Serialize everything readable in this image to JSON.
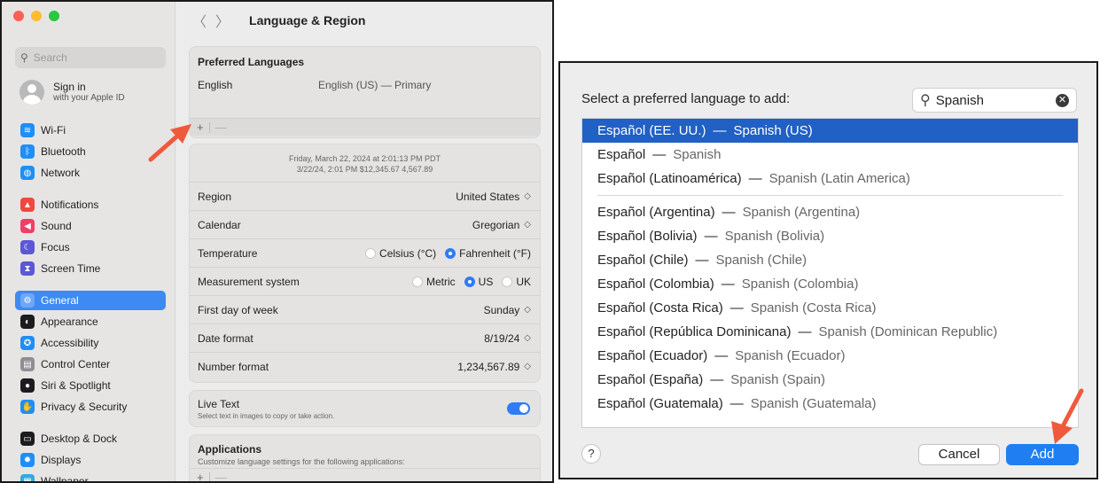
{
  "settings_window": {
    "search_placeholder": "Search",
    "account": {
      "title": "Sign in",
      "subtitle": "with your Apple ID"
    },
    "sidebar_groups": [
      [
        {
          "label": "Wi-Fi",
          "icon": "wifi-icon",
          "color": "#1f8ef6"
        },
        {
          "label": "Bluetooth",
          "icon": "bluetooth-icon",
          "color": "#1f8ef6"
        },
        {
          "label": "Network",
          "icon": "globe-icon",
          "color": "#1f8ef6"
        }
      ],
      [
        {
          "label": "Notifications",
          "icon": "bell-icon",
          "color": "#f0473e"
        },
        {
          "label": "Sound",
          "icon": "speaker-icon",
          "color": "#f03e67"
        },
        {
          "label": "Focus",
          "icon": "moon-icon",
          "color": "#5b57d6"
        },
        {
          "label": "Screen Time",
          "icon": "hourglass-icon",
          "color": "#5b57d6"
        }
      ],
      [
        {
          "label": "General",
          "icon": "gear-icon",
          "color": "#8e8e93",
          "active": true
        },
        {
          "label": "Appearance",
          "icon": "appearance-icon",
          "color": "#1c1c1e"
        },
        {
          "label": "Accessibility",
          "icon": "accessibility-icon",
          "color": "#1f8ef6"
        },
        {
          "label": "Control Center",
          "icon": "control-center-icon",
          "color": "#8e8e93"
        },
        {
          "label": "Siri & Spotlight",
          "icon": "siri-icon",
          "color": "#1c1c1e"
        },
        {
          "label": "Privacy & Security",
          "icon": "hand-icon",
          "color": "#1f8ef6"
        }
      ],
      [
        {
          "label": "Desktop & Dock",
          "icon": "dock-icon",
          "color": "#1c1c1e"
        },
        {
          "label": "Displays",
          "icon": "sun-icon",
          "color": "#1f8ef6"
        },
        {
          "label": "Wallpaper",
          "icon": "wallpaper-icon",
          "color": "#34aadc"
        }
      ]
    ],
    "title": "Language & Region",
    "preferred": {
      "header": "Preferred Languages",
      "language": "English",
      "detail": "English (US) — Primary",
      "add": "+",
      "remove": "—"
    },
    "preview": {
      "line1": "Friday, March 22, 2024 at 2:01:13 PM PDT",
      "line2": "3/22/24, 2:01 PM   $12,345.67   4,567.89"
    },
    "rows": {
      "region": {
        "label": "Region",
        "value": "United States"
      },
      "calendar": {
        "label": "Calendar",
        "value": "Gregorian"
      },
      "temperature": {
        "label": "Temperature",
        "options": [
          "Celsius (°C)",
          "Fahrenheit (°F)"
        ],
        "selected": "Fahrenheit (°F)"
      },
      "measurement": {
        "label": "Measurement system",
        "options": [
          "Metric",
          "US",
          "UK"
        ],
        "selected": "US"
      },
      "first_day": {
        "label": "First day of week",
        "value": "Sunday"
      },
      "date_format": {
        "label": "Date format",
        "value": "8/19/24"
      },
      "number_format": {
        "label": "Number format",
        "value": "1,234,567.89"
      }
    },
    "live_text": {
      "title": "Live Text",
      "description": "Select text in images to copy or take action.",
      "enabled": true
    },
    "applications": {
      "title": "Applications",
      "description": "Customize language settings for the following applications:",
      "add": "+",
      "remove": "—"
    },
    "stepper_glyph": "◇"
  },
  "language_dialog": {
    "prompt": "Select a preferred language to add:",
    "search_value": "Spanish",
    "clear_glyph": "✕",
    "dash": "—",
    "languages_top": [
      {
        "native": "Español (EE. UU.)",
        "english": "Spanish (US)",
        "selected": true
      },
      {
        "native": "Español",
        "english": "Spanish"
      },
      {
        "native": "Español (Latinoamérica)",
        "english": "Spanish (Latin America)"
      }
    ],
    "languages": [
      {
        "native": "Español (Argentina)",
        "english": "Spanish (Argentina)"
      },
      {
        "native": "Español (Bolivia)",
        "english": "Spanish (Bolivia)"
      },
      {
        "native": "Español (Chile)",
        "english": "Spanish (Chile)"
      },
      {
        "native": "Español (Colombia)",
        "english": "Spanish (Colombia)"
      },
      {
        "native": "Español (Costa Rica)",
        "english": "Spanish (Costa Rica)"
      },
      {
        "native": "Español (República Dominicana)",
        "english": "Spanish (Dominican Republic)"
      },
      {
        "native": "Español (Ecuador)",
        "english": "Spanish (Ecuador)"
      },
      {
        "native": "Español (España)",
        "english": "Spanish (Spain)"
      },
      {
        "native": "Español (Guatemala)",
        "english": "Spanish (Guatemala)"
      }
    ],
    "help_label": "?",
    "cancel_label": "Cancel",
    "add_label": "Add"
  },
  "annotation_color": "#ef5a3c"
}
